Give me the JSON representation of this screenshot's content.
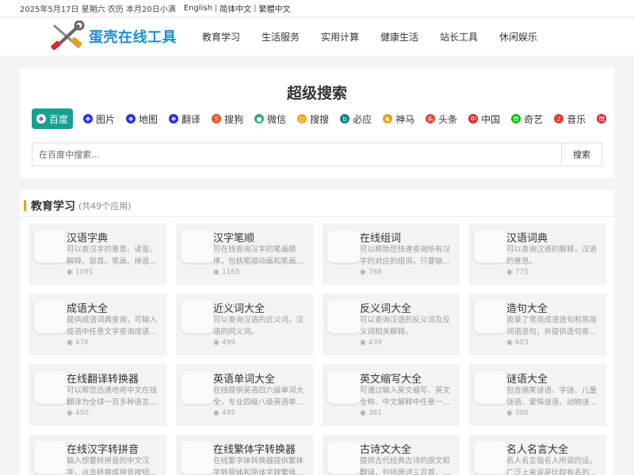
{
  "topbar": {
    "date": "2025年5月17日 星期六 农历 本月20日小满",
    "langs": [
      "English",
      "简体中文",
      "繁體中文"
    ],
    "sep": "|"
  },
  "logo": {
    "text": "蛋壳在线工具"
  },
  "nav": [
    "教育学习",
    "生活服务",
    "实用计算",
    "健康生活",
    "站长工具",
    "休闲娱乐"
  ],
  "search": {
    "title": "超级搜索",
    "placeholder": "在百度中搜索...",
    "button": "搜索",
    "engines": [
      {
        "label": "百度",
        "icon": "baidu-paw-icon",
        "color": "#2932e1",
        "glyph": "❖",
        "active": true
      },
      {
        "label": "图片",
        "icon": "baidu-paw-icon",
        "color": "#2932e1",
        "glyph": "❖"
      },
      {
        "label": "地图",
        "icon": "baidu-paw-icon",
        "color": "#2932e1",
        "glyph": "❖"
      },
      {
        "label": "翻译",
        "icon": "baidu-paw-icon",
        "color": "#2932e1",
        "glyph": "❖"
      },
      {
        "label": "搜狗",
        "icon": "sogou-icon",
        "color": "#e8512a",
        "glyph": "S"
      },
      {
        "label": "微信",
        "icon": "wechat-icon",
        "color": "#2aae67",
        "glyph": "●"
      },
      {
        "label": "搜搜",
        "icon": "soso-icon",
        "color": "#f5a623",
        "glyph": "○"
      },
      {
        "label": "必应",
        "icon": "bing-icon",
        "color": "#0c8484",
        "glyph": "b"
      },
      {
        "label": "神马",
        "icon": "shenma-icon",
        "color": "#f39c12",
        "glyph": "♞"
      },
      {
        "label": "头条",
        "icon": "toutiao-icon",
        "color": "#e33e33",
        "glyph": "头"
      },
      {
        "label": "中国",
        "icon": "chinaso-icon",
        "color": "#d7261f",
        "glyph": "中"
      },
      {
        "label": "奇艺",
        "icon": "iqiyi-icon",
        "color": "#00be06",
        "glyph": "奇"
      },
      {
        "label": "音乐",
        "icon": "music-icon",
        "color": "#e33e33",
        "glyph": "♪"
      },
      {
        "label": "",
        "icon": "weibo-icon",
        "color": "#e6162d",
        "glyph": "微"
      }
    ]
  },
  "education": {
    "title": "教育学习",
    "count": "(共49个应用)",
    "view_icon": "eye-icon",
    "cards": [
      {
        "title": "汉语字典",
        "desc": "可以查汉字的意思、读音、解释、部首、笔画、拼音...",
        "views": "1091"
      },
      {
        "title": "汉字笔顺",
        "desc": "可在线查询汉字的笔画顺序，包括笔顺动画和笔画...",
        "views": "1165"
      },
      {
        "title": "在线组词",
        "desc": "可以帮助您快速查询所有汉字的对应的组词，只要输...",
        "views": "768"
      },
      {
        "title": "汉语词典",
        "desc": "可以查询汉语的解释，汉语的意思。",
        "views": "775"
      },
      {
        "title": "成语大全",
        "desc": "提供成语词典查询，可输入成语中任意文字查询成语...",
        "views": "476"
      },
      {
        "title": "近义词大全",
        "desc": "可以查询汉语的近义词，汉语的同义词。",
        "views": "499"
      },
      {
        "title": "反义词大全",
        "desc": "可以查询汉语的反义词及反义词相关解释。",
        "views": "439"
      },
      {
        "title": "造句大全",
        "desc": "收录了常用成语造句和常用词语造句，并提供造句查...",
        "views": "603"
      },
      {
        "title": "在线翻译转换器",
        "desc": "可以帮您迅速地将中文在线翻译为全球一百多种语言...",
        "views": "450"
      },
      {
        "title": "英语单词大全",
        "desc": "在线提供英语四六级单词大全，专业四级八级英语单...",
        "views": "495"
      },
      {
        "title": "英文缩写大全",
        "desc": "可通过输入英文缩写、英文全称、中文解释中任意一...",
        "views": "361"
      },
      {
        "title": "谜语大全",
        "desc": "包含搞笑谜语、字谜、儿童谜语、爱情谜语、动物谜...",
        "views": "306"
      },
      {
        "title": "在线汉字转拼音",
        "desc": "输入想要转拼音的中文汉字，点击转换成拼音按钮...",
        "views": ""
      },
      {
        "title": "在线繁体字转换器",
        "desc": "在线繁字体转换器提供繁体字转简体和简体字转繁体...",
        "views": ""
      },
      {
        "title": "古诗文大全",
        "desc": "提供古代经典古诗的原文和翻译，包括唐诗三百首、...",
        "views": ""
      },
      {
        "title": "名人名言大全",
        "desc": "名人名言指名人所说的话，广泛上来说是比较有名的...",
        "views": ""
      }
    ]
  }
}
